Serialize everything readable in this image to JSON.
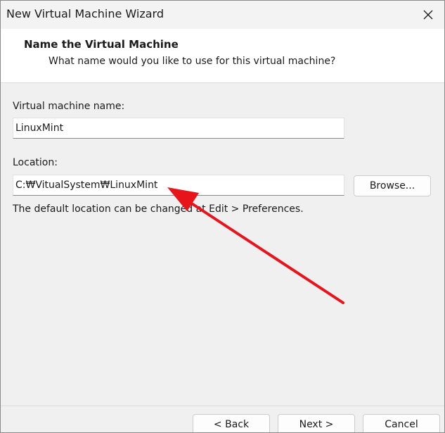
{
  "window": {
    "title": "New Virtual Machine Wizard"
  },
  "header": {
    "title": "Name the Virtual Machine",
    "subtitle": "What name would you like to use for this virtual machine?"
  },
  "form": {
    "name_label": "Virtual machine name:",
    "name_value": "LinuxMint",
    "location_label": "Location:",
    "location_value": "C:₩VitualSystem₩LinuxMint",
    "browse_label": "Browse...",
    "hint": "The default location can be changed at Edit > Preferences."
  },
  "footer": {
    "back_label": "< Back",
    "next_label": "Next >",
    "cancel_label": "Cancel"
  },
  "icons": {
    "close": "close-icon"
  },
  "colors": {
    "annotation_arrow": "#e8141c"
  }
}
